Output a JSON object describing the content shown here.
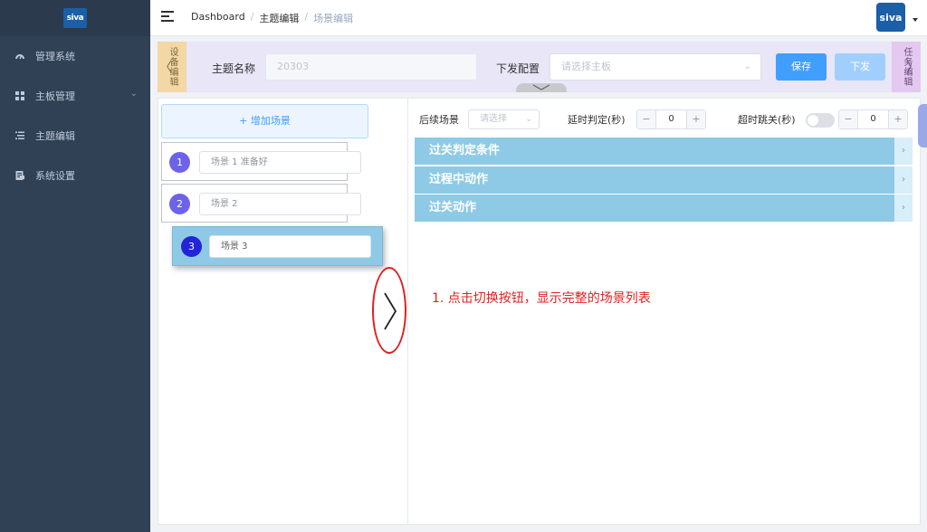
{
  "app": {
    "logo_text": "siva",
    "avatar_text": "siva"
  },
  "sidebar": {
    "items": [
      {
        "label": "管理系统",
        "icon": "dashboard-icon"
      },
      {
        "label": "主板管理",
        "icon": "grid-icon",
        "has_submenu": true
      },
      {
        "label": "主题编辑",
        "icon": "list-icon"
      },
      {
        "label": "系统设置",
        "icon": "document-icon"
      }
    ]
  },
  "header": {
    "breadcrumb": [
      "Dashboard",
      "主题编辑",
      "场景编辑"
    ],
    "breadcrumb_sep": "/"
  },
  "toolbar": {
    "left_tab": "设备编辑",
    "right_tab": "任务编辑",
    "theme_label": "主题名称",
    "theme_value": "20303",
    "dispatch_label": "下发配置",
    "board_placeholder": "请选择主板",
    "save_label": "保存",
    "dispatch_button": "下发"
  },
  "scenes": {
    "add_label": "+ 增加场景",
    "items": [
      {
        "num": "1",
        "name": "场景 1 准备好"
      },
      {
        "num": "2",
        "name": "场景 2"
      },
      {
        "num": "3",
        "name": "场景 3"
      }
    ]
  },
  "controls": {
    "next_scene_label": "后续场景",
    "next_scene_placeholder": "请选择",
    "delay_label": "延时判定(秒)",
    "delay_value": "0",
    "timeout_label": "超时跳关(秒)",
    "timeout_value": "0",
    "timeout_enabled": false,
    "dec_symbol": "−",
    "inc_symbol": "+"
  },
  "sections": [
    {
      "title": "过关判定条件"
    },
    {
      "title": "过程中动作"
    },
    {
      "title": "过关动作"
    }
  ],
  "annotation": "1. 点击切换按钮，显示完整的场景列表",
  "colors": {
    "sidebar_bg": "#304156",
    "primary": "#409eff",
    "section_bg": "#8ecae6",
    "annotation": "#e02020",
    "scene_num": "#6c63e8"
  }
}
